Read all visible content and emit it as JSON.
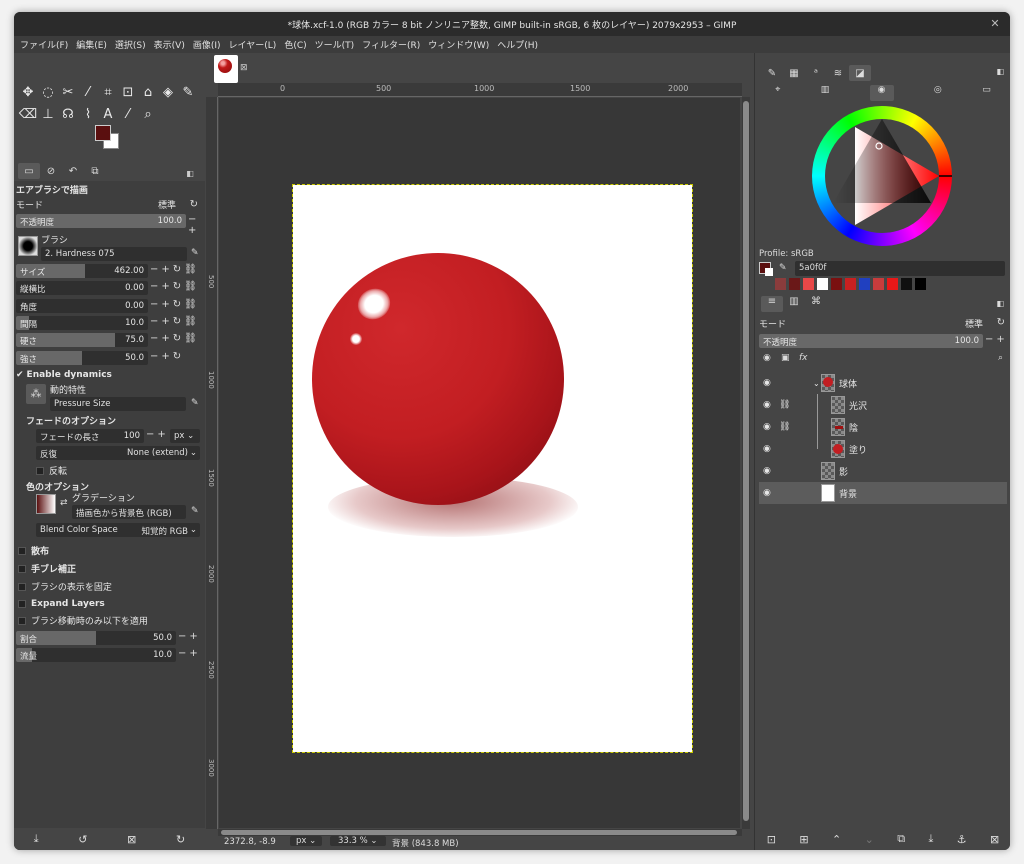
{
  "window": {
    "title": "*球体.xcf-1.0 (RGB カラー 8 bit ノンリニア整数, GIMP built-in sRGB, 6 枚のレイヤー) 2079x2953 – GIMP"
  },
  "menu": [
    "ファイル(F)",
    "編集(E)",
    "選択(S)",
    "表示(V)",
    "画像(I)",
    "レイヤー(L)",
    "色(C)",
    "ツール(T)",
    "フィルター(R)",
    "ウィンドウ(W)",
    "ヘルプ(H)"
  ],
  "colors": {
    "foreground": "#5a0f0f",
    "background": "#ffffff",
    "sphere": "#c21e22"
  },
  "tool_options": {
    "title": "エアブラシで描画",
    "mode_label": "モード",
    "mode_value": "標準",
    "opacity": {
      "label": "不透明度",
      "value": "100.0",
      "fraction": 1.0
    },
    "brush_label": "ブラシ",
    "brush_name": "2. Hardness 075",
    "sliders": [
      {
        "label": "サイズ",
        "value": "462.00",
        "fraction": 0.52
      },
      {
        "label": "縦横比",
        "value": "0.00",
        "fraction": 0.0
      },
      {
        "label": "角度",
        "value": "0.00",
        "fraction": 0.0
      },
      {
        "label": "間隔",
        "value": "10.0",
        "fraction": 0.1
      },
      {
        "label": "硬さ",
        "value": "75.0",
        "fraction": 0.75
      },
      {
        "label": "強さ",
        "value": "50.0",
        "fraction": 0.5
      }
    ],
    "enable_dynamics": "Enable dynamics",
    "dynamics_label": "動的特性",
    "dynamics_value": "Pressure Size",
    "fade_section": "フェードのオプション",
    "fade_length": {
      "label": "フェードの長さ",
      "value": "100",
      "unit": "px"
    },
    "repeat": {
      "label": "反復",
      "value": "None (extend)"
    },
    "reverse": "反転",
    "color_section": "色のオプション",
    "gradient_label": "グラデーション",
    "gradient_value": "描画色から背景色 (RGB)",
    "blend_space": {
      "label": "Blend Color Space",
      "value": "知覚的 RGB"
    },
    "scatter": "散布",
    "smoothing": "手ブレ補正",
    "lock_brush": "ブラシの表示を固定",
    "expand_layers": "Expand Layers",
    "apply_jitter": "ブラシ移動時のみ以下を適用",
    "rate": {
      "label": "割合",
      "value": "50.0",
      "fraction": 0.5
    },
    "flow": {
      "label": "流量",
      "value": "10.0",
      "fraction": 0.1
    }
  },
  "ruler_h": [
    "0",
    "500",
    "1000",
    "1500",
    "2000"
  ],
  "ruler_v": [
    "500",
    "1000",
    "1500",
    "2000",
    "2500",
    "3000"
  ],
  "status": {
    "coords": "2372.8, -8.9",
    "unit": "px",
    "zoom": "33.3 %",
    "info": "背景 (843.8 MB)"
  },
  "colors_dock": {
    "profile": "Profile: sRGB",
    "hex": "5a0f0f",
    "history": [
      "#8a3c3c",
      "#6a1818",
      "#e84848",
      "#ffffff",
      "#7a1010",
      "#c82020",
      "#2040c0",
      "#c83c3c",
      "#e81818",
      "#101010",
      "#000000"
    ]
  },
  "layers": {
    "mode_label": "モード",
    "mode_value": "標準",
    "opacity_label": "不透明度",
    "opacity_value": "100.0",
    "items": [
      {
        "name": "球体",
        "linked": false
      },
      {
        "name": "光沢",
        "linked": true
      },
      {
        "name": "陰",
        "linked": true
      },
      {
        "name": "塗り",
        "linked": false
      },
      {
        "name": "影",
        "linked": false
      },
      {
        "name": "背景",
        "linked": false
      }
    ]
  }
}
